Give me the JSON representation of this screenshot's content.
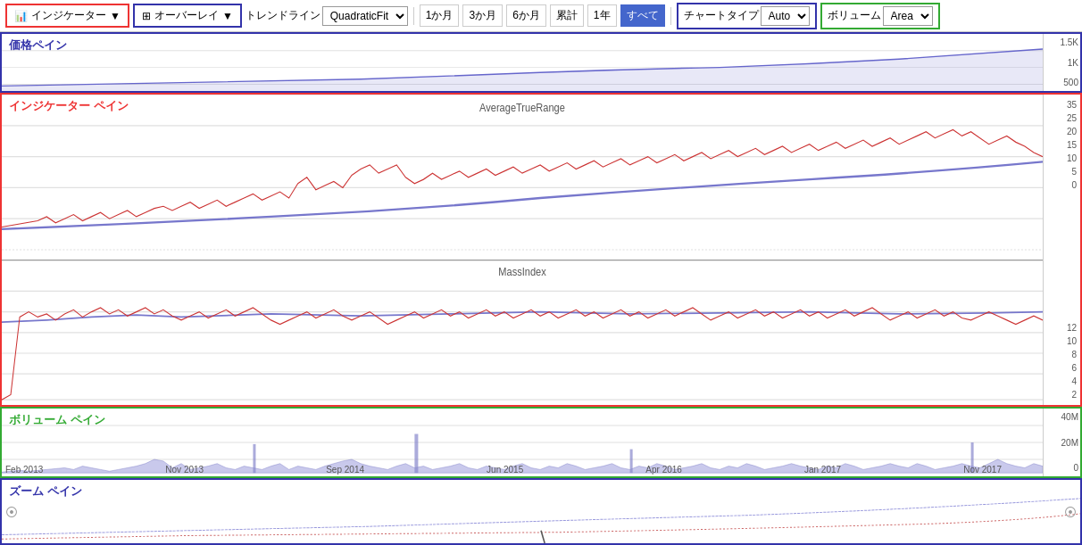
{
  "toolbar": {
    "indicator_label": "インジケーター",
    "overlay_label": "オーバーレイ",
    "trendline_label": "トレンドライン",
    "trendline_value": "QuadraticFit",
    "time_buttons": [
      "1か月",
      "3か月",
      "6か月",
      "累計",
      "1年",
      "すべて"
    ],
    "active_time": "すべて",
    "chart_type_label": "チャートタイプ",
    "chart_type_value": "Auto",
    "volume_label": "ボリューム",
    "volume_value": "Area"
  },
  "panes": {
    "price_label": "価格ペイン",
    "price_y_axis": [
      "1.5K",
      "1K",
      "500"
    ],
    "indicator_label": "インジケーター ペイン",
    "indicator1_title": "AverageTrueRange",
    "indicator1_y_axis": [
      "35",
      "25",
      "20",
      "15",
      "10",
      "5",
      "0"
    ],
    "indicator2_title": "MassIndex",
    "indicator2_y_axis": [
      "12",
      "10",
      "8",
      "6",
      "4",
      "2"
    ],
    "volume_label": "ボリューム ペイン",
    "volume_y_axis": [
      "40M",
      "20M",
      "0"
    ],
    "zoom_label": "ズーム ペイン"
  },
  "date_axis": [
    "Feb 2013",
    "Nov 2013",
    "Sep 2014",
    "Jun 2015",
    "Apr 2016",
    "Jan 2017",
    "Nov 2017"
  ]
}
